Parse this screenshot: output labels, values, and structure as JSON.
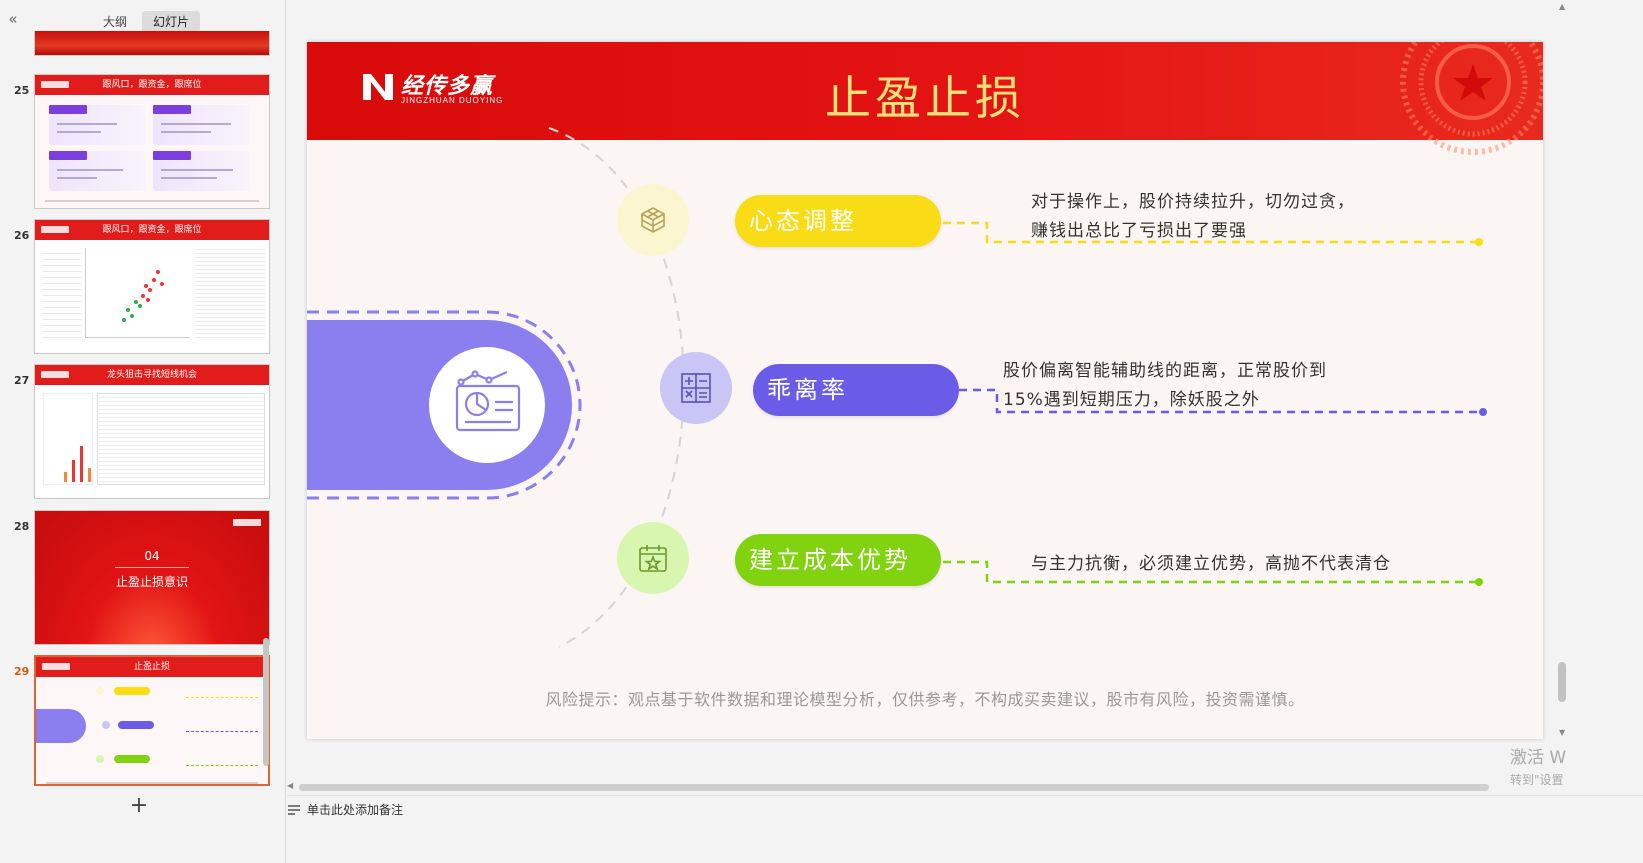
{
  "left_panel": {
    "tabs": [
      "大纲",
      "幻灯片"
    ],
    "active_tab": "幻灯片",
    "collapse_icon": "double-chevron-left-icon",
    "add_slide_icon": "plus-icon",
    "thumbnails": [
      {
        "number": "25",
        "title": "跟风口，跟资金，跟席位"
      },
      {
        "number": "26",
        "title": "跟风口，跟资金，跟席位"
      },
      {
        "number": "27",
        "title": "龙头狙击寻找短线机会"
      },
      {
        "number": "28",
        "title": "止盈止损意识",
        "section": "04"
      },
      {
        "number": "29",
        "title": "止盈止损",
        "active": true
      }
    ]
  },
  "slide": {
    "logo_text": "经传多赢",
    "logo_sub": "JINGZHUAN DUOYING",
    "title": "止盈止损",
    "center_icon": "chart-report-icon",
    "items": [
      {
        "label": "心态调整",
        "color": "#f9dc16",
        "circle_color": "#fbf6cf",
        "icon": "cube-icon",
        "desc_lines": [
          "对于操作上，股价持续拉升，切勿过贪，",
          "赚钱出总比了亏损出了要强"
        ]
      },
      {
        "label": "乖离率",
        "color": "#6a5ce6",
        "circle_color": "#c9c5f5",
        "icon": "calculator-icon",
        "desc_lines": [
          "股价偏离智能辅助线的距离，正常股价到",
          "15%遇到短期压力，除妖股之外"
        ]
      },
      {
        "label": "建立成本优势",
        "color": "#82d30f",
        "circle_color": "#d9f6b0",
        "icon": "calendar-star-icon",
        "desc_lines": [
          "与主力抗衡，必须建立优势，高抛不代表清仓"
        ]
      }
    ],
    "risk_note": "风险提示：观点基于软件数据和理论模型分析，仅供参考，不构成买卖建议，股市有风险，投资需谨慎。",
    "colors": {
      "header": "#e01010",
      "title": "#f7e27a",
      "center": "#8b7ff0"
    }
  },
  "watermark": {
    "line1": "激活 W",
    "line2": "转到\"设置"
  },
  "notes": {
    "placeholder": "单击此处添加备注",
    "icon": "notes-list-icon"
  }
}
